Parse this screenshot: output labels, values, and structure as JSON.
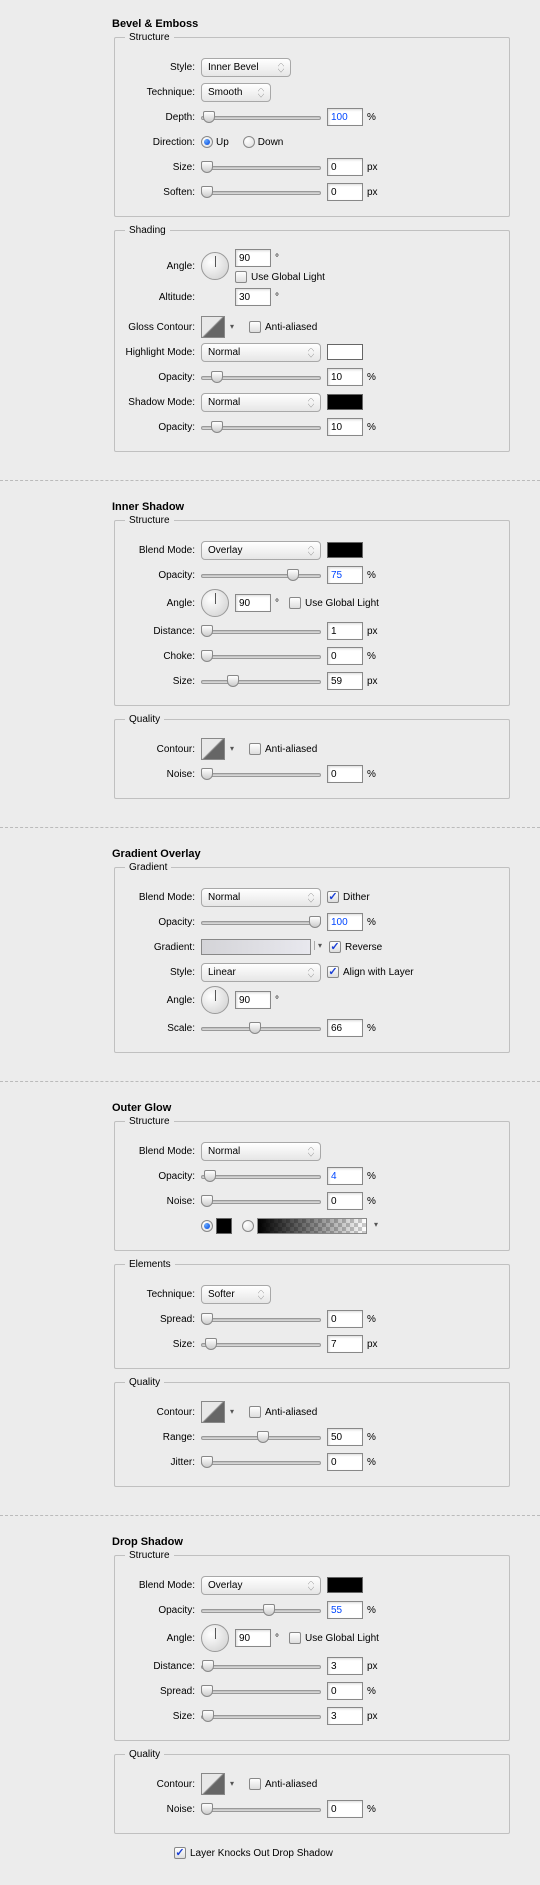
{
  "bevel": {
    "title": "Bevel & Emboss",
    "structure": "Structure",
    "shading": "Shading",
    "lbl_style": "Style:",
    "style": "Inner Bevel",
    "lbl_technique": "Technique:",
    "technique": "Smooth",
    "lbl_depth": "Depth:",
    "depth": "100",
    "pct": "%",
    "lbl_direction": "Direction:",
    "up": "Up",
    "down": "Down",
    "lbl_size": "Size:",
    "size": "0",
    "px": "px",
    "lbl_soften": "Soften:",
    "soften": "0",
    "lbl_angle": "Angle:",
    "angle": "90",
    "deg": "°",
    "use_global": "Use Global Light",
    "lbl_altitude": "Altitude:",
    "altitude": "30",
    "lbl_gloss": "Gloss Contour:",
    "antialiased": "Anti-aliased",
    "lbl_highlight": "Highlight Mode:",
    "highlight_mode": "Normal",
    "lbl_opacity": "Opacity:",
    "h_opacity": "10",
    "lbl_shadowmode": "Shadow Mode:",
    "shadow_mode": "Normal",
    "s_opacity": "10"
  },
  "inner_shadow": {
    "title": "Inner Shadow",
    "structure": "Structure",
    "quality": "Quality",
    "lbl_blend": "Blend Mode:",
    "blend": "Overlay",
    "lbl_opacity": "Opacity:",
    "opacity": "75",
    "pct": "%",
    "lbl_angle": "Angle:",
    "angle": "90",
    "deg": "°",
    "use_global": "Use Global Light",
    "lbl_distance": "Distance:",
    "distance": "1",
    "px": "px",
    "lbl_choke": "Choke:",
    "choke": "0",
    "lbl_size": "Size:",
    "size": "59",
    "lbl_contour": "Contour:",
    "antialiased": "Anti-aliased",
    "lbl_noise": "Noise:",
    "noise": "0"
  },
  "gradient_overlay": {
    "title": "Gradient Overlay",
    "gradient_grp": "Gradient",
    "lbl_blend": "Blend Mode:",
    "blend": "Normal",
    "dither": "Dither",
    "lbl_opacity": "Opacity:",
    "opacity": "100",
    "pct": "%",
    "lbl_gradient": "Gradient:",
    "reverse": "Reverse",
    "lbl_style": "Style:",
    "style": "Linear",
    "align": "Align with Layer",
    "lbl_angle": "Angle:",
    "angle": "90",
    "deg": "°",
    "lbl_scale": "Scale:",
    "scale": "66"
  },
  "outer_glow": {
    "title": "Outer Glow",
    "structure": "Structure",
    "elements": "Elements",
    "quality": "Quality",
    "lbl_blend": "Blend Mode:",
    "blend": "Normal",
    "lbl_opacity": "Opacity:",
    "opacity": "4",
    "pct": "%",
    "lbl_noise": "Noise:",
    "noise": "0",
    "lbl_technique": "Technique:",
    "technique": "Softer",
    "lbl_spread": "Spread:",
    "spread": "0",
    "lbl_size": "Size:",
    "size": "7",
    "px": "px",
    "lbl_contour": "Contour:",
    "antialiased": "Anti-aliased",
    "lbl_range": "Range:",
    "range": "50",
    "lbl_jitter": "Jitter:",
    "jitter": "0"
  },
  "drop_shadow": {
    "title": "Drop Shadow",
    "structure": "Structure",
    "quality": "Quality",
    "lbl_blend": "Blend Mode:",
    "blend": "Overlay",
    "lbl_opacity": "Opacity:",
    "opacity": "55",
    "pct": "%",
    "lbl_angle": "Angle:",
    "angle": "90",
    "deg": "°",
    "use_global": "Use Global Light",
    "lbl_distance": "Distance:",
    "distance": "3",
    "px": "px",
    "lbl_spread": "Spread:",
    "spread": "0",
    "lbl_size": "Size:",
    "size": "3",
    "lbl_contour": "Contour:",
    "antialiased": "Anti-aliased",
    "lbl_noise": "Noise:",
    "noise": "0",
    "knockout": "Layer Knocks Out Drop Shadow"
  },
  "chart_data": null
}
